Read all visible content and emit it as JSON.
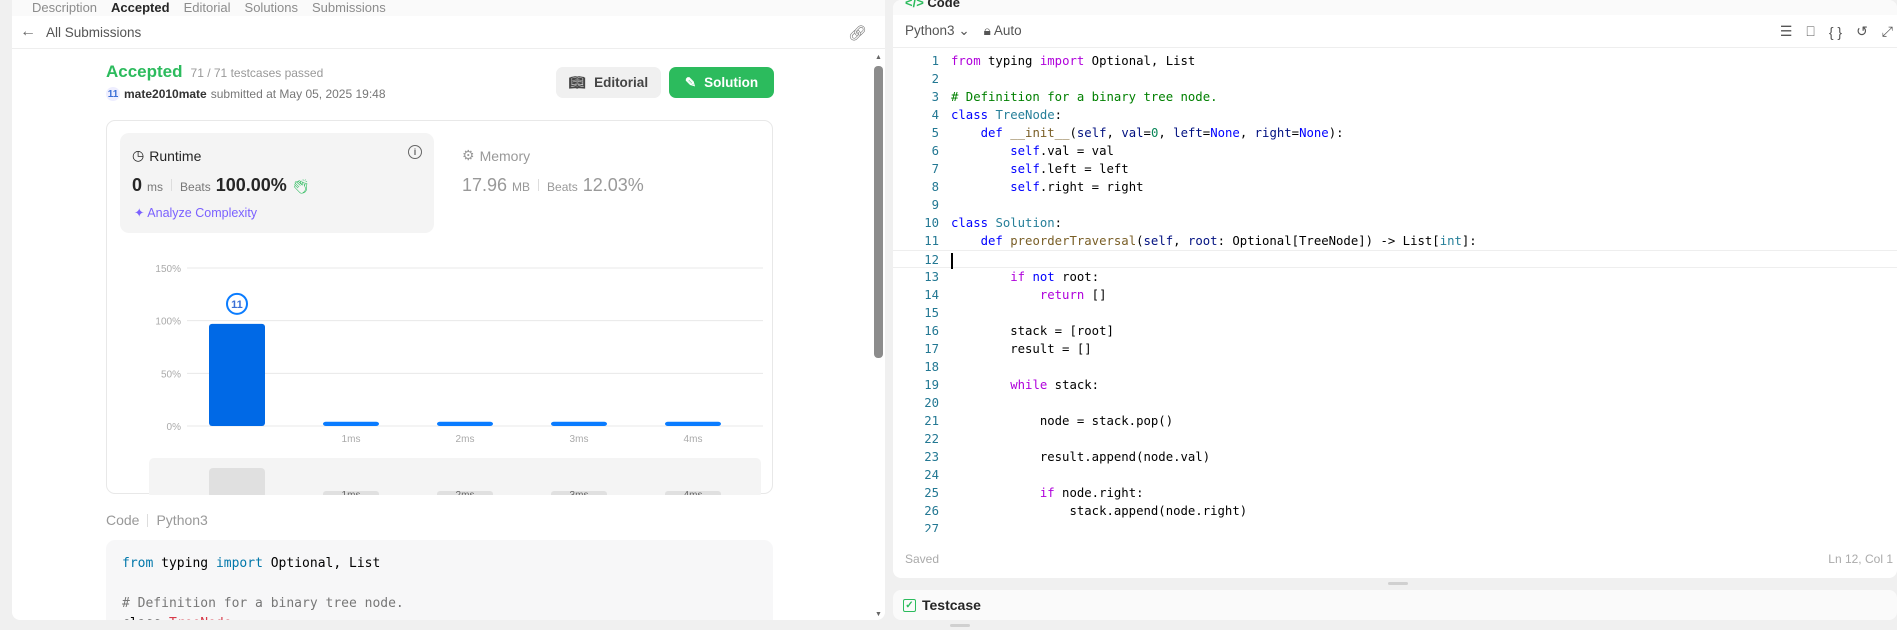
{
  "top_tabs": [
    "Description",
    "Accepted",
    "Editorial",
    "Solutions",
    "Submissions"
  ],
  "back_label": "All Submissions",
  "submission": {
    "status": "Accepted",
    "testcases": "71 / 71 testcases passed",
    "user": "mate2010mate",
    "submitted_at": "submitted at May 05, 2025 19:48",
    "editorial_label": "Editorial",
    "solution_label": "Solution"
  },
  "runtime": {
    "label": "Runtime",
    "value": "0",
    "unit": "ms",
    "beats_label": "Beats",
    "beats": "100.00%",
    "analyze": "Analyze Complexity"
  },
  "memory": {
    "label": "Memory",
    "value": "17.96",
    "unit": "MB",
    "beats_label": "Beats",
    "beats": "12.03%"
  },
  "chart_data": {
    "type": "bar",
    "categories": [
      "0ms",
      "1ms",
      "2ms",
      "3ms",
      "4ms"
    ],
    "tick_labels": [
      "",
      "1ms",
      "2ms",
      "3ms",
      "4ms"
    ],
    "values": [
      97,
      4,
      4,
      4,
      4
    ],
    "ylim": [
      0,
      150
    ],
    "yticks": [
      "0%",
      "50%",
      "100%",
      "150%"
    ],
    "ytick_values": [
      0,
      50,
      100,
      150
    ],
    "marker_on": "0ms",
    "color": "#0069e6"
  },
  "code_section": {
    "label": "Code",
    "language": "Python3"
  },
  "left_code": [
    [
      [
        "from",
        "lkw"
      ],
      [
        " typing ",
        "pl"
      ],
      [
        "import",
        "lkw"
      ],
      [
        " Optional, List",
        "pl"
      ]
    ],
    [],
    [
      [
        "# Definition for a binary tree node.",
        "lcm"
      ]
    ],
    [
      [
        "class ",
        "pl"
      ],
      [
        "TreeNode",
        "lty"
      ],
      [
        ":",
        "pl"
      ]
    ]
  ],
  "right_header": {
    "title": "Code",
    "language": "Python3",
    "mode": "Auto"
  },
  "editor_lines": [
    [
      [
        "from",
        "kw"
      ],
      [
        " typing ",
        "pl"
      ],
      [
        "import",
        "kw"
      ],
      [
        " Optional, List",
        "pl"
      ]
    ],
    [],
    [
      [
        "# Definition for a binary tree node.",
        "cm"
      ]
    ],
    [
      [
        "class",
        "kb"
      ],
      [
        " ",
        "pl"
      ],
      [
        "TreeNode",
        "ty"
      ],
      [
        ":",
        "pl"
      ]
    ],
    [
      [
        "    ",
        "pl"
      ],
      [
        "def",
        "kb"
      ],
      [
        " ",
        "pl"
      ],
      [
        "__init__",
        "fn"
      ],
      [
        "(",
        "pl"
      ],
      [
        "self",
        "pm"
      ],
      [
        ", ",
        "pl"
      ],
      [
        "val",
        "pm"
      ],
      [
        "=",
        "pl"
      ],
      [
        "0",
        "nm"
      ],
      [
        ", ",
        "pl"
      ],
      [
        "left",
        "pm"
      ],
      [
        "=",
        "pl"
      ],
      [
        "None",
        "kb"
      ],
      [
        ", ",
        "pl"
      ],
      [
        "right",
        "pm"
      ],
      [
        "=",
        "pl"
      ],
      [
        "None",
        "kb"
      ],
      [
        "):",
        "pl"
      ]
    ],
    [
      [
        "        ",
        "pl"
      ],
      [
        "self",
        "kb"
      ],
      [
        ".val = val",
        "pl"
      ]
    ],
    [
      [
        "        ",
        "pl"
      ],
      [
        "self",
        "kb"
      ],
      [
        ".left = left",
        "pl"
      ]
    ],
    [
      [
        "        ",
        "pl"
      ],
      [
        "self",
        "kb"
      ],
      [
        ".right = right",
        "pl"
      ]
    ],
    [],
    [
      [
        "class",
        "kb"
      ],
      [
        " ",
        "pl"
      ],
      [
        "Solution",
        "ty"
      ],
      [
        ":",
        "pl"
      ]
    ],
    [
      [
        "    ",
        "pl"
      ],
      [
        "def",
        "kb"
      ],
      [
        " ",
        "pl"
      ],
      [
        "preorderTraversal",
        "fn"
      ],
      [
        "(",
        "pl"
      ],
      [
        "self",
        "pm"
      ],
      [
        ", ",
        "pl"
      ],
      [
        "root",
        "pm"
      ],
      [
        ": Optional[TreeNode]) -> List[",
        "pl"
      ],
      [
        "int",
        "ty"
      ],
      [
        "]:",
        "pl"
      ]
    ],
    [],
    [
      [
        "        ",
        "pl"
      ],
      [
        "if",
        "kw"
      ],
      [
        " ",
        "pl"
      ],
      [
        "not",
        "kb"
      ],
      [
        " root:",
        "pl"
      ]
    ],
    [
      [
        "            ",
        "pl"
      ],
      [
        "return",
        "kw"
      ],
      [
        " []",
        "pl"
      ]
    ],
    [],
    [
      [
        "        stack = [root]",
        "pl"
      ]
    ],
    [
      [
        "        result = []",
        "pl"
      ]
    ],
    [],
    [
      [
        "        ",
        "pl"
      ],
      [
        "while",
        "kw"
      ],
      [
        " stack:",
        "pl"
      ]
    ],
    [],
    [
      [
        "            node = stack.pop()",
        "pl"
      ]
    ],
    [],
    [
      [
        "            result.append(node.val)",
        "pl"
      ]
    ],
    [],
    [
      [
        "            ",
        "pl"
      ],
      [
        "if",
        "kw"
      ],
      [
        " node.right:",
        "pl"
      ]
    ],
    [
      [
        "                stack.append(node.right)",
        "pl"
      ]
    ],
    []
  ],
  "cursor_line": 12,
  "editor_status": {
    "saved": "Saved",
    "position": "Ln 12, Col 1"
  },
  "testcase_label": "Testcase"
}
